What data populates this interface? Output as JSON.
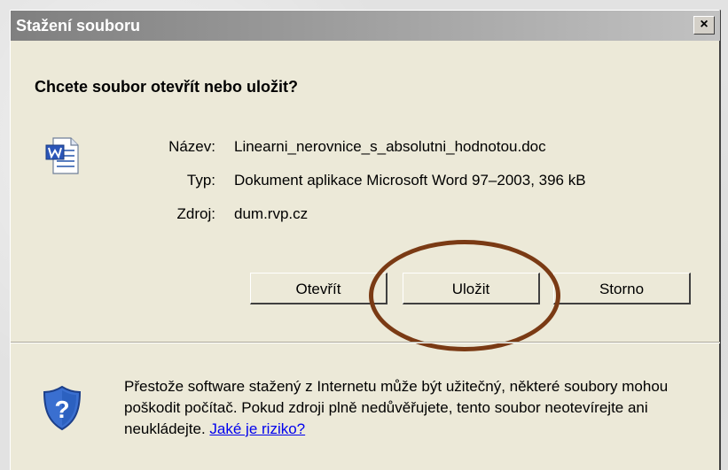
{
  "dialog": {
    "title": "Stažení souboru",
    "close_glyph": "×",
    "heading": "Chcete soubor otevřít nebo uložit?",
    "file": {
      "name_label": "Název:",
      "name_value": "Linearni_nerovnice_s_absolutni_hodnotou.doc",
      "type_label": "Typ:",
      "type_value": "Dokument aplikace Microsoft Word 97–2003, 396 kB",
      "source_label": "Zdroj:",
      "source_value": "dum.rvp.cz"
    },
    "buttons": {
      "open": "Otevřít",
      "save": "Uložit",
      "cancel": "Storno"
    },
    "warning": {
      "text": "Přestože software stažený z Internetu může být užitečný, některé soubory mohou poškodit počítač. Pokud zdroji plně nedůvěřujete, tento soubor neotevírejte ani neukládejte.",
      "link": "Jaké je riziko?"
    },
    "icons": {
      "file": "word-document-icon",
      "warning": "security-shield-icon",
      "close": "close-icon"
    },
    "highlight_color": "#7a3a14"
  }
}
